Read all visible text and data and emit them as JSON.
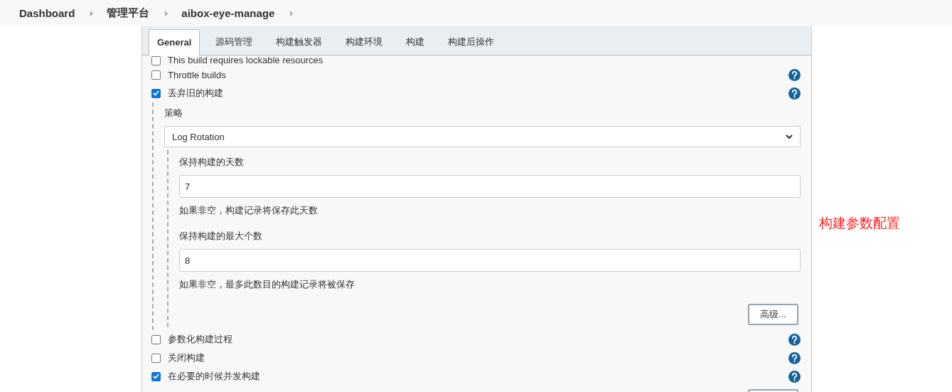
{
  "breadcrumb": [
    {
      "label": "Dashboard"
    },
    {
      "label": "管理平台"
    },
    {
      "label": "aibox-eye-manage"
    }
  ],
  "tabs": [
    {
      "label": "General",
      "selected": true
    },
    {
      "label": "源码管理",
      "selected": false
    },
    {
      "label": "构建触发器",
      "selected": false
    },
    {
      "label": "构建环境",
      "selected": false
    },
    {
      "label": "构建",
      "selected": false
    },
    {
      "label": "构建后操作",
      "selected": false
    }
  ],
  "options": [
    {
      "label": "This build requires lockable resources",
      "checked": false,
      "help": false
    },
    {
      "label": "Throttle builds",
      "checked": false,
      "help": true
    },
    {
      "label": "丢弃旧的构建",
      "checked": true,
      "help": true,
      "details": {
        "strategy_label": "策略",
        "strategy": {
          "value": "Log Rotation"
        },
        "fields": [
          {
            "label": "保持构建的天数",
            "value": "7",
            "hint": "如果非空，构建记录将保存此天数"
          },
          {
            "label": "保持构建的最大个数",
            "value": "8",
            "hint": "如果非空，最多此数目的构建记录将被保存"
          }
        ],
        "advanced_button": "高级..."
      }
    },
    {
      "label": "参数化构建过程",
      "checked": false,
      "help": true
    },
    {
      "label": "关闭构建",
      "checked": false,
      "help": true
    },
    {
      "label": "在必要的时候并发构建",
      "checked": true,
      "help": true
    }
  ],
  "footer_button": {
    "kind": "button"
  },
  "annotation": {
    "text": "构建参数配置"
  }
}
